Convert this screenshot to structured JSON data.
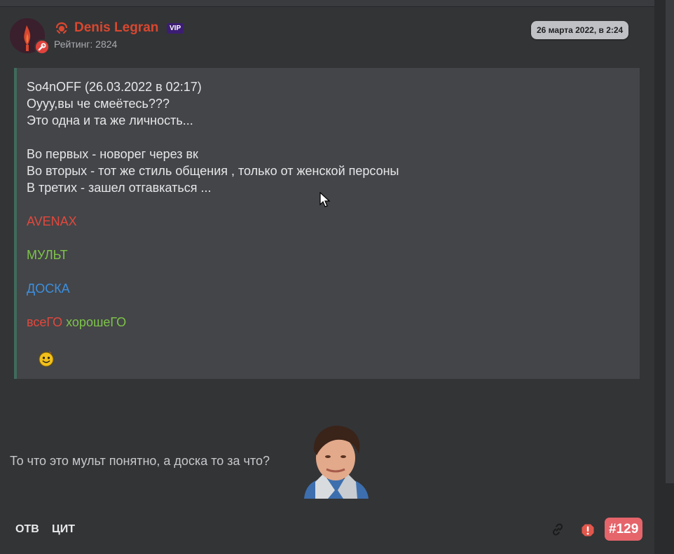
{
  "post": {
    "author": {
      "name": "Denis Legran",
      "badge": "VIP",
      "rating": "Рейтинг: 2824",
      "name_color": "#d9472f",
      "avatar_icon": "flame-icon",
      "avatar_badge_icon": "wrench-icon"
    },
    "date": "26 марта 2022, в 2:24",
    "quote": {
      "lines": [
        "So4nOFF (26.03.2022 в 02:17)",
        "Оууу,вы че смеётесь???",
        "Это одна и та же личность...",
        "Во первых - новорег через вк",
        "Во вторых - тот же стиль общения , только от женской персоны",
        "В третих - зашел отгавкаться ..."
      ],
      "colored": {
        "avenax": "AVENAX",
        "mult": "МУЛЬТ",
        "doska": "ДОСКА",
        "vsego": "всеГО",
        "horoshego": "хорошеГО"
      },
      "colors": {
        "red": "#e2483d",
        "green": "#7dc44a",
        "blue": "#3c8fe0"
      },
      "emoji": "smiley-icon"
    },
    "reply_text": "То что это мульт понятно, а доска то за что?",
    "reply_image": "meme-face-image",
    "footer": {
      "reply_label": "ОТВ",
      "quote_label": "ЦИТ",
      "link_icon": "link-icon",
      "report_icon": "report-icon",
      "post_number": "#129"
    }
  }
}
